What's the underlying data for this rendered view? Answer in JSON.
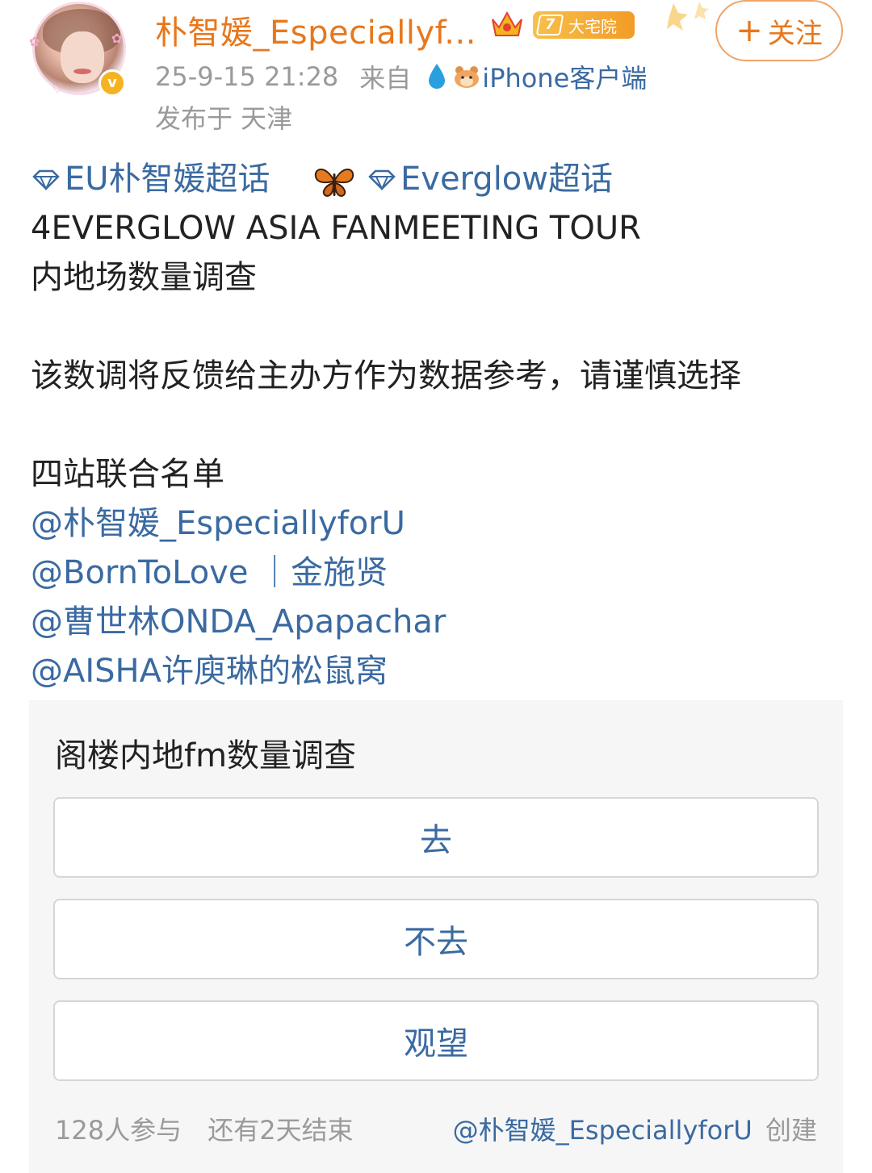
{
  "header": {
    "username": "朴智媛_Especiallyf...",
    "level": "7",
    "level_badge_label": "大宅院",
    "follow_label": "关注",
    "timestamp": "25-9-15 21:28",
    "source_prefix": "来自",
    "source_client": "iPhone客户端",
    "location": "发布于 天津",
    "verified_mark": "v"
  },
  "post": {
    "topic_1": "EU朴智媛超话",
    "topic_2": "Everglow超话",
    "line_1": "4EVERGLOW ASIA FANMEETING TOUR",
    "line_2": "内地场数量调查",
    "line_3": "该数调将反馈给主办方作为数据参考，请谨慎选择",
    "line_4": "四站联合名单",
    "mentions": [
      "@朴智媛_EspeciallyforU",
      "@BornToLove ｜金施贤",
      "@曹世林ONDA_Apapachar",
      "@AISHA许庾琳的松鼠窝"
    ]
  },
  "poll": {
    "title": "阁楼内地fm数量调查",
    "options": [
      "去",
      "不去",
      "观望"
    ],
    "participants": "128人参与",
    "ends": "还有2天结束",
    "creator": "@朴智媛_EspeciallyforU",
    "created_label": "创建"
  },
  "colors": {
    "username": "#e8771c",
    "link": "#3a6aa1",
    "muted": "#9a9a9a",
    "poll_bg": "#f6f6f6"
  }
}
